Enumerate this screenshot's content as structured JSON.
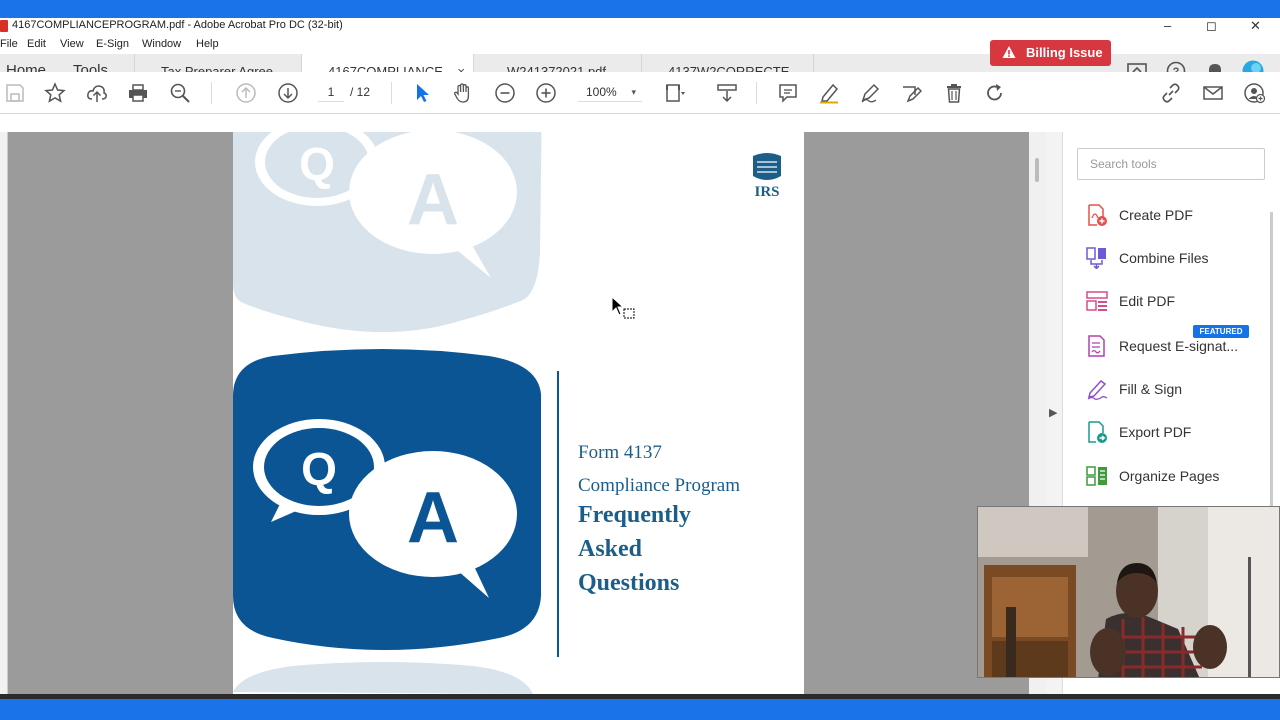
{
  "window": {
    "title": "4167COMPLIANCEPROGRAM.pdf - Adobe Acrobat Pro DC (32-bit)",
    "minimize": "–",
    "maximize": "◻",
    "close": "✕"
  },
  "menu": {
    "items": [
      "File",
      "Edit",
      "View",
      "E-Sign",
      "Window",
      "Help"
    ]
  },
  "nav": {
    "home": "Home",
    "tools": "Tools"
  },
  "tabs": [
    {
      "label": "Tax Preparer Agree..."
    },
    {
      "label": "4167COMPLIANCE...",
      "close": "×"
    },
    {
      "label": "W241372021.pdf"
    },
    {
      "label": "4137W2CORRECTE..."
    }
  ],
  "header": {
    "billing_label": "Billing Issue"
  },
  "toolbar": {
    "page_current": "1",
    "page_total": "/ 12",
    "zoom": "100%",
    "zoom_caret": "▾"
  },
  "document": {
    "irs_logo_text": "IRS",
    "q_letter": "Q",
    "a_letter": "A",
    "form_line": "Form 4137",
    "program_line": "Compliance Program",
    "title_lines": [
      "Frequently",
      "Asked",
      "Questions"
    ]
  },
  "tools_pane": {
    "search_placeholder": "Search tools",
    "featured_badge": "FEATURED",
    "items": [
      {
        "label": "Create PDF",
        "icon": "create-pdf-icon"
      },
      {
        "label": "Combine Files",
        "icon": "combine-files-icon"
      },
      {
        "label": "Edit PDF",
        "icon": "edit-pdf-icon"
      },
      {
        "label": "Request E-signat...",
        "icon": "request-esign-icon"
      },
      {
        "label": "Fill & Sign",
        "icon": "fill-sign-icon"
      },
      {
        "label": "Export PDF",
        "icon": "export-pdf-icon"
      },
      {
        "label": "Organize Pages",
        "icon": "organize-pages-icon"
      }
    ]
  },
  "colors": {
    "accent": "#1a73e8",
    "billing": "#d7373f",
    "irs_blue": "#0b5594",
    "irs_text": "#1b5e8a",
    "faded_blue": "#d8e3ec",
    "create_pdf": "#e5504b",
    "combine": "#6f5ad6",
    "edit_pdf": "#d94c8c",
    "request_esign": "#b042b2",
    "fill_sign": "#8b4fd0",
    "export_pdf": "#1a9a8b",
    "organize": "#3f9b3c"
  }
}
